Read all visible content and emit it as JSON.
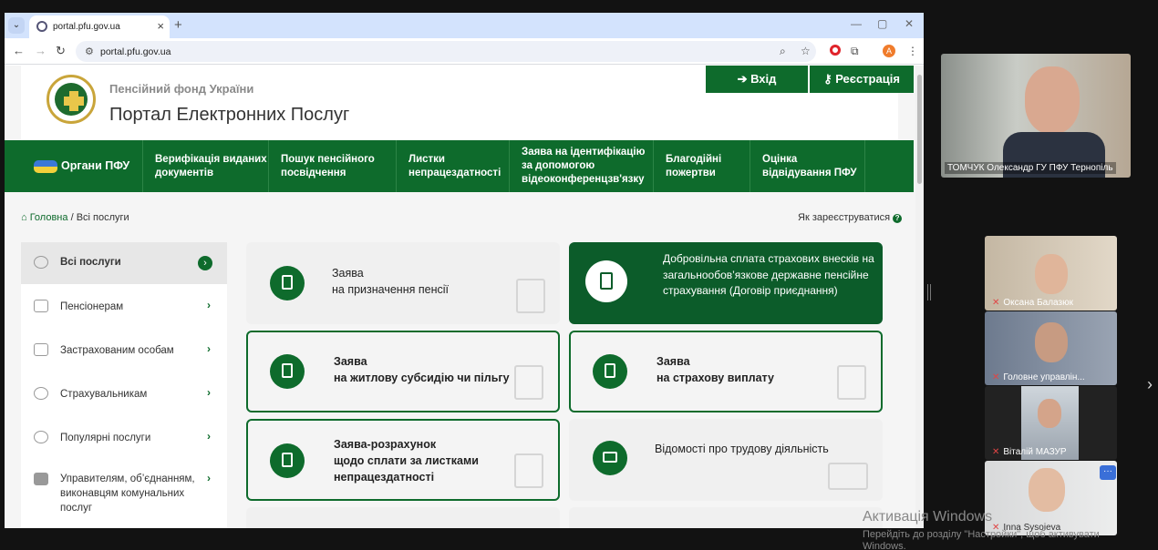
{
  "browser": {
    "tab_title": "portal.pfu.gov.ua",
    "url": "portal.pfu.gov.ua",
    "new_tab": "+",
    "tab_close": "×",
    "win_min": "—",
    "win_max": "▢",
    "win_close": "✕",
    "profile_initial": "A"
  },
  "header": {
    "org": "Пенсійний фонд України",
    "portal": "Портал Електронних Послуг",
    "login": "Вхід",
    "register": "Реєстрація"
  },
  "nav": [
    {
      "label": "Органи ПФУ"
    },
    {
      "label": "Верифікація виданих документів"
    },
    {
      "label": "Пошук пенсійного посвідчення"
    },
    {
      "label": "Листки непрацездатності"
    },
    {
      "label": "Заява на ідентифікацію за допомогою відеоконференцзв'язку"
    },
    {
      "label": "Благодійні пожертви"
    },
    {
      "label": "Оцінка відвідування ПФУ"
    }
  ],
  "breadcrumb": {
    "home": "Головна",
    "sep": "/",
    "current": "Всі послуги"
  },
  "how_register": "Як зареєструватися",
  "sidebar": [
    {
      "label": "Всі послуги"
    },
    {
      "label": "Пенсіонерам"
    },
    {
      "label": "Застрахованим особам"
    },
    {
      "label": "Страхувальникам"
    },
    {
      "label": "Популярні послуги"
    },
    {
      "label": "Управителям, об’єднанням, виконавцям комунальних послуг"
    }
  ],
  "cards": [
    {
      "line1": "Заява",
      "line2": "на призначення пенсії"
    },
    {
      "text": "Добровільна сплата страхових внесків на загальнообов’язкове державне пенсійне страхування (Договір приєднання)"
    },
    {
      "line1": "Заява",
      "line2": "на житлову субсидію чи пільгу"
    },
    {
      "line1": "Заява",
      "line2": "на страхову виплату"
    },
    {
      "line1": "Заява-розрахунок",
      "line2": "щодо сплати за листками",
      "line3": "непрацездатності"
    },
    {
      "text": "Відомості про трудову діяльність"
    }
  ],
  "video": {
    "main_name": "ТОМЧУК Олександр ГУ ПФУ Тернопіль",
    "participants": [
      {
        "name": "Оксана Балазюк"
      },
      {
        "name": "Головне управлін..."
      },
      {
        "name": "Віталій МАЗУР"
      },
      {
        "name": "Inna Sysoieva"
      }
    ],
    "more": "···"
  },
  "windows_activation": {
    "title": "Активація Windows",
    "subtitle": "Перейдіть до розділу \"Настройки\", щоб активувати Windows."
  }
}
